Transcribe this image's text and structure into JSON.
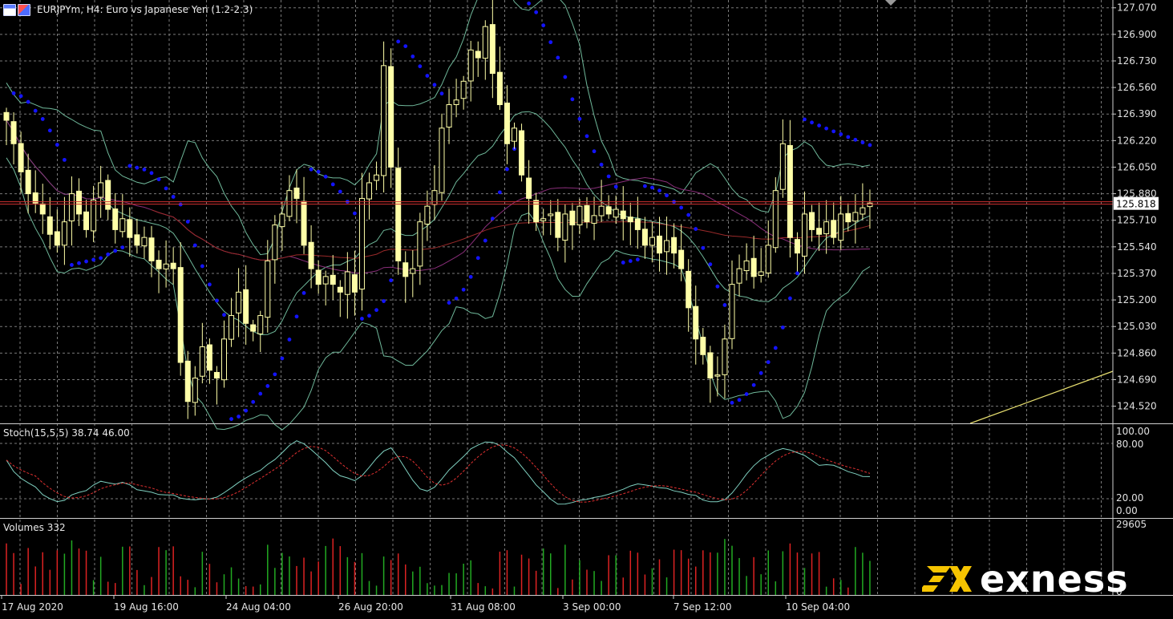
{
  "window": {
    "title": "EURJPYm, H4:  Euro vs Japanese Yen (1.2-2.3)"
  },
  "price_axis": {
    "labels": [
      "127.070",
      "126.900",
      "126.730",
      "126.560",
      "126.390",
      "126.220",
      "126.050",
      "125.880",
      "125.710",
      "125.540",
      "125.370",
      "125.200",
      "125.030",
      "124.860",
      "124.690",
      "124.520"
    ],
    "current_price": "125.818"
  },
  "stoch": {
    "label": "Stoch(15,5,5) 38.74 46.00",
    "levels": [
      "100.00",
      "80.00",
      "20.00",
      "0.00"
    ]
  },
  "volumes": {
    "label": "Volumes 332",
    "max_label": "29605",
    "min_label": "0"
  },
  "time_axis": {
    "labels": [
      "17 Aug 2020",
      "19 Aug 16:00",
      "24 Aug 04:00",
      "26 Aug 20:00",
      "31 Aug 08:00",
      "3 Sep 00:00",
      "7 Sep 12:00",
      "10 Sep 04:00"
    ]
  },
  "branding": {
    "logo_text": "exness"
  },
  "colors": {
    "background": "#000000",
    "grid": "#7a7a7a",
    "candle": "#ffffa8",
    "price_line": "#d03030",
    "parabolic_sar": "#1414ff",
    "bollinger": "#6fb89a",
    "ma_fast": "#8a2e7a",
    "ma_slow": "#9a2a2a",
    "stoch_main": "#7fd0c0",
    "stoch_signal": "#e03030",
    "volume_up": "#22aa22",
    "volume_down": "#dd2222",
    "logo_mark": "#f6c400"
  },
  "chart_data": {
    "type": "candlestick",
    "symbol": "EURJPYm",
    "timeframe": "H4",
    "ylim": [
      124.41,
      127.12
    ],
    "current_price": 125.818,
    "close": [
      126.35,
      126.2,
      126.02,
      125.88,
      125.82,
      125.75,
      125.62,
      125.55,
      125.7,
      125.88,
      125.75,
      125.65,
      125.84,
      125.95,
      125.78,
      125.65,
      125.72,
      125.6,
      125.55,
      125.6,
      125.45,
      125.4,
      125.43,
      125.4,
      124.8,
      124.55,
      124.7,
      124.9,
      124.75,
      124.7,
      124.95,
      125.1,
      125.25,
      125.05,
      125.0,
      125.1,
      125.45,
      125.68,
      125.75,
      125.9,
      125.85,
      125.55,
      125.4,
      125.3,
      125.35,
      125.3,
      125.25,
      125.38,
      125.25,
      125.85,
      125.95,
      126.0,
      126.7,
      126.05,
      125.45,
      125.35,
      125.4,
      125.7,
      125.8,
      125.9,
      126.3,
      126.45,
      126.48,
      126.6,
      126.8,
      126.75,
      126.95,
      126.65,
      126.45,
      126.2,
      126.3,
      126.0,
      125.85,
      125.7,
      125.72,
      125.75,
      125.6,
      125.75,
      125.68,
      125.8,
      125.7,
      125.74,
      125.8,
      125.75,
      125.78,
      125.72,
      125.7,
      125.65,
      125.55,
      125.6,
      125.5,
      125.58,
      125.5,
      125.4,
      125.15,
      124.95,
      124.85,
      124.7,
      124.72,
      124.95,
      125.3,
      125.4,
      125.45,
      125.35,
      125.38,
      125.55,
      125.9,
      126.2,
      125.6,
      125.5,
      125.75,
      125.65,
      125.62,
      125.7,
      125.6,
      125.75,
      125.7,
      125.76,
      125.79,
      125.82
    ],
    "overlays": [
      "Bollinger Bands",
      "Parabolic SAR",
      "Moving Average (fast)",
      "Moving Average (slow)"
    ],
    "stochastic": {
      "params": "15,5,5",
      "main": [
        38.74
      ],
      "signal": [
        46.0
      ],
      "levels": [
        80,
        20
      ]
    },
    "volume": {
      "last": 332,
      "max": 29605
    }
  }
}
